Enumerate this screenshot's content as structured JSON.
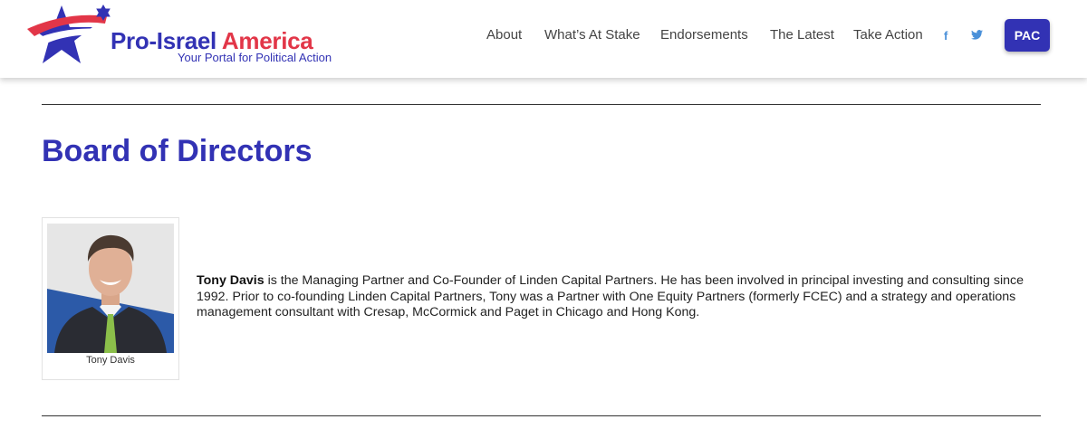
{
  "brand": {
    "name_part1": "Pro-Israel",
    "name_part2": "America",
    "tagline": "Your Portal for Political Action",
    "colors": {
      "blue": "#3232b4",
      "red": "#e23648"
    }
  },
  "nav": {
    "items": [
      "About",
      "What’s At Stake",
      "Endorsements",
      "The Latest",
      "Take Action"
    ],
    "social": [
      {
        "icon": "facebook-icon",
        "glyph": "f"
      },
      {
        "icon": "twitter-icon",
        "glyph": "🐦"
      }
    ],
    "pac_label": "PAC"
  },
  "page": {
    "title": "Board of Directors"
  },
  "director": {
    "caption": "Tony Davis",
    "bio_name": "Tony Davis",
    "bio_text": " is the Managing Partner and Co-Founder of Linden Capital Partners. He has been involved in principal investing and consulting since 1992. Prior to co-founding Linden Capital Partners, Tony was a Partner with One Equity Partners (formerly FCEC) and a strategy and operations management consultant with Cresap, McCormick and Paget in Chicago and Hong Kong.",
    "photo_icon": "portrait-photo"
  }
}
